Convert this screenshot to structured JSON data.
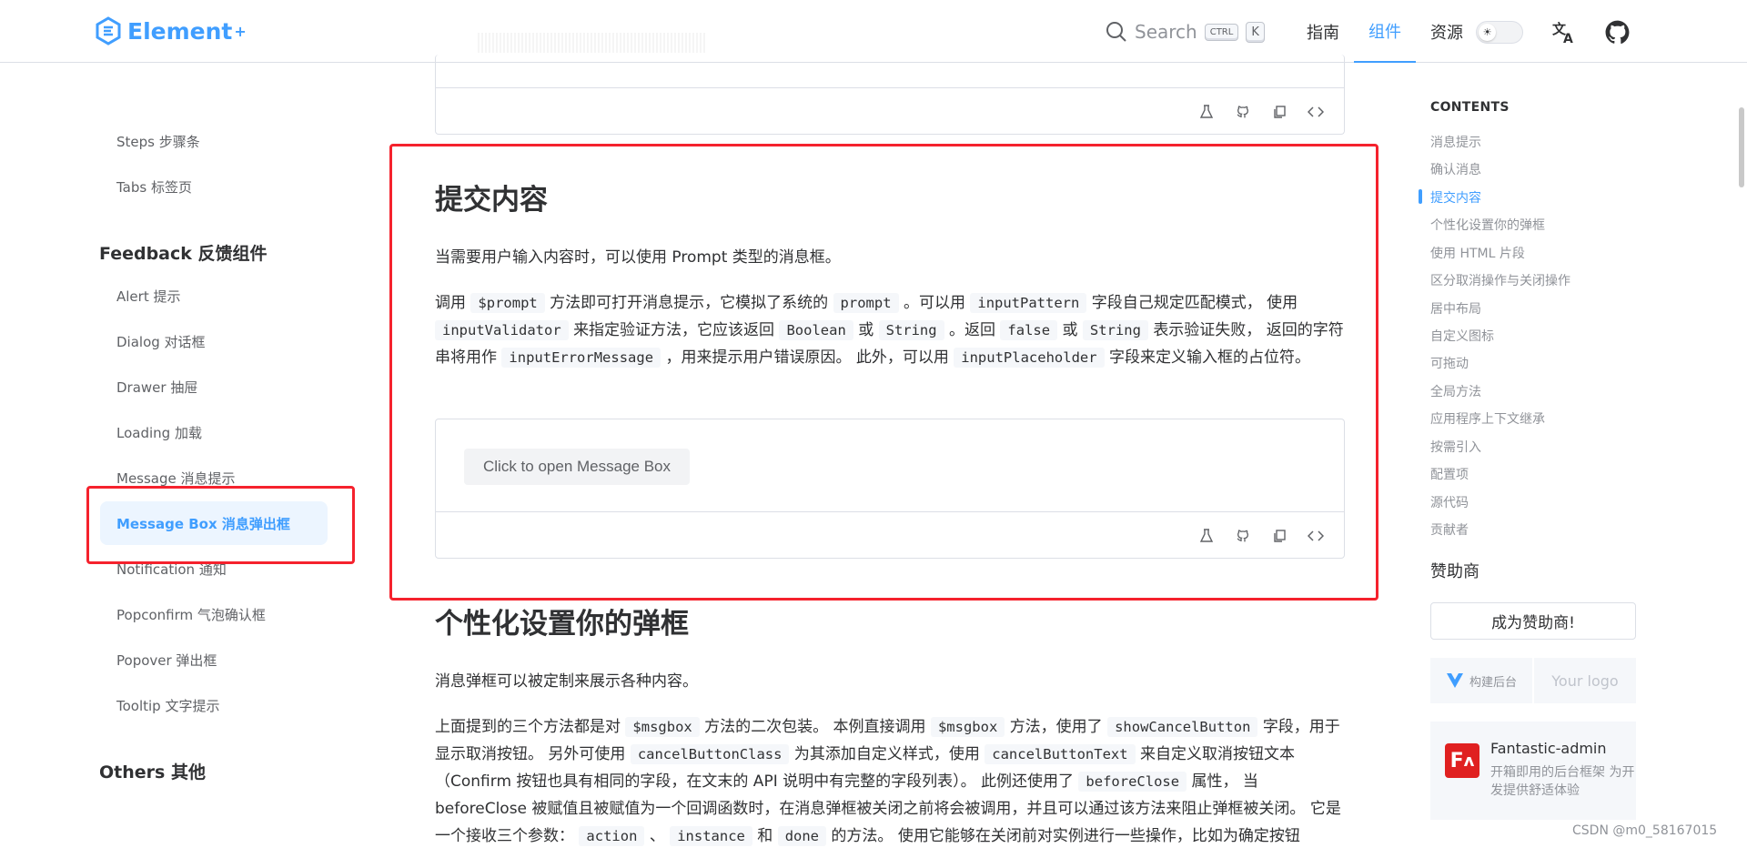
{
  "header": {
    "logo_text": "Element",
    "logo_sup": "+",
    "search_label": "Search",
    "kbd_ctrl": "CTRL",
    "kbd_k": "K",
    "nav": [
      "指南",
      "组件",
      "资源"
    ],
    "active_nav": "组件",
    "accent_color": "#409eff"
  },
  "sidebar": {
    "items_top": [
      "Steps 步骤条",
      "Tabs 标签页"
    ],
    "group_feedback": "Feedback 反馈组件",
    "items_feedback": [
      "Alert 提示",
      "Dialog 对话框",
      "Drawer 抽屉",
      "Loading 加载",
      "Message 消息提示",
      "Message Box 消息弹出框",
      "Notification 通知",
      "Popconfirm 气泡确认框",
      "Popover 弹出框",
      "Tooltip 文字提示"
    ],
    "active_item": "Message Box 消息弹出框",
    "group_others": "Others 其他"
  },
  "main": {
    "section1": {
      "title": "提交内容",
      "intro": "当需要用户输入内容时，可以使用 Prompt 类型的消息框。",
      "p": {
        "t1": "调用",
        "c1": "$prompt",
        "t2": "方法即可打开消息提示，它模拟了系统的",
        "c2": "prompt",
        "t3": "。可以用",
        "c3": "inputPattern",
        "t4": "字段自己规定匹配模式， 使用",
        "c4": "inputValidator",
        "t5": "来指定验证方法，它应该返回",
        "c5": "Boolean",
        "t6": "或",
        "c6": "String",
        "t7": "。返回",
        "c7": "false",
        "t8": "或",
        "c8": "String",
        "t9": "表示验证失败， 返回的字符串将用作",
        "c9": "inputErrorMessage",
        "t10": "，用来提示用户错误原因。 此外，可以用",
        "c10": "inputPlaceholder",
        "t11": "字段来定义输入框的占位符。"
      },
      "demo_button": "Click to open Message Box"
    },
    "section2": {
      "title": "个性化设置你的弹框",
      "intro": "消息弹框可以被定制来展示各种内容。",
      "p": {
        "t1": "上面提到的三个方法都是对",
        "c1": "$msgbox",
        "t2": "方法的二次包装。 本例直接调用",
        "c2": "$msgbox",
        "t3": "方法，使用了",
        "c3": "showCancelButton",
        "t4": "字段，用于显示取消按钮。 另外可使用",
        "c4": "cancelButtonClass",
        "t5": "为其添加自定义样式，使用",
        "c5": "cancelButtonText",
        "t6": "来自定义取消按钮文本（Confirm 按钮也具有相同的字段，在文末的 API 说明中有完整的字段列表）。 此例还使用了",
        "c6": "beforeClose",
        "t7": "属性， 当 beforeClose 被赋值且被赋值为一个回调函数时，在消息弹框被关闭之前将会被调用，并且可以通过该方法来阻止弹框被关闭。 它是一个接收三个参数：",
        "c7": "action",
        "t8": "、",
        "c8": "instance",
        "t9": "和",
        "c9": "done",
        "t10": "的方法。 使用它能够在关闭前对实例进行一些操作，比如为确定按钮"
      }
    }
  },
  "toc": {
    "title": "CONTENTS",
    "items": [
      "消息提示",
      "确认消息",
      "提交内容",
      "个性化设置你的弹框",
      "使用 HTML 片段",
      "区分取消操作与关闭操作",
      "居中布局",
      "自定义图标",
      "可拖动",
      "全局方法",
      "应用程序上下文继承",
      "按需引入",
      "配置项",
      "源代码",
      "贡献者"
    ],
    "active": "提交内容"
  },
  "sponsors": {
    "title": "赞助商",
    "become_button": "成为赞助商!",
    "logo_a_text": "构建后台",
    "logo_b_text": "Your logo",
    "fa_logo_letters": "F",
    "fa_name": "Fantastic-admin",
    "fa_desc": "开箱即用的后台框架 为开发提供舒适体验"
  },
  "watermark": "CSDN @m0_58167015",
  "annotation_color": "#f5222d"
}
